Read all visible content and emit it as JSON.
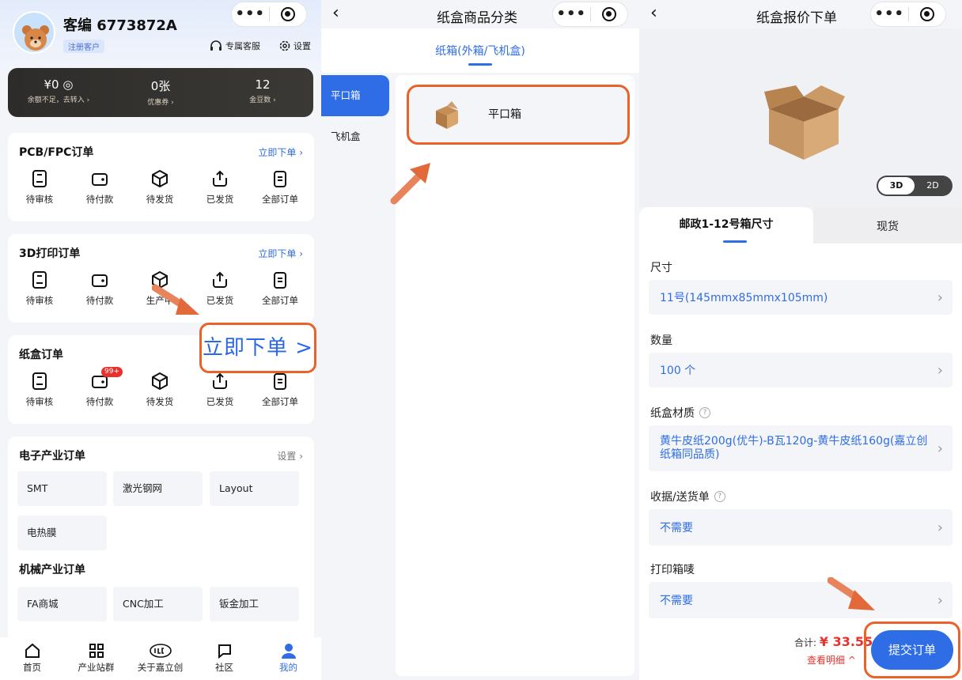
{
  "left": {
    "user": {
      "name": "客编 6773872A",
      "badge": "注册客户"
    },
    "header_links": {
      "service": "专属客服",
      "settings": "设置"
    },
    "stats": [
      {
        "value": "¥0 ◎",
        "sub": "余额不足，去转入 ›"
      },
      {
        "value": "0张",
        "sub": "优惠券 ›"
      },
      {
        "value": "12",
        "sub": "金豆数 ›"
      }
    ],
    "pcb": {
      "title": "PCB/FPC订单",
      "link": "立即下单 ›",
      "items": [
        "待审核",
        "待付款",
        "待发货",
        "已发货",
        "全部订单"
      ]
    },
    "print3d": {
      "title": "3D打印订单",
      "link": "立即下单 ›",
      "items": [
        "待审核",
        "待付款",
        "生产中",
        "已发货",
        "全部订单"
      ]
    },
    "box": {
      "title": "纸盒订单",
      "badge": "99+",
      "items": [
        "待审核",
        "待付款",
        "待发货",
        "已发货",
        "全部订单"
      ]
    },
    "callout": "立即下单 >",
    "electronics": {
      "title": "电子产业订单",
      "link": "设置 ›",
      "tiles": [
        "SMT",
        "激光钢网",
        "Layout",
        "电热膜"
      ]
    },
    "mechanical": {
      "title": "机械产业订单",
      "tiles": [
        "FA商城",
        "CNC加工",
        "钣金加工"
      ]
    },
    "tabbar": [
      "首页",
      "产业站群",
      "关于嘉立创",
      "社区",
      "我的"
    ],
    "tabbar_active_color": "#2f6de6"
  },
  "middle": {
    "title": "纸盒商品分类",
    "tab": "纸箱(外箱/飞机盒)",
    "menu": [
      "平口箱",
      "飞机盒"
    ],
    "item": "平口箱"
  },
  "right": {
    "title": "纸盒报价下单",
    "toggle": [
      "3D",
      "2D"
    ],
    "tabs": [
      "邮政1-12号箱尺寸",
      "现货"
    ],
    "fields": [
      {
        "label": "尺寸",
        "value": "11号(145mmx85mmx105mm)"
      },
      {
        "label": "数量",
        "value": "100 个"
      },
      {
        "label": "纸盒材质",
        "value": "黄牛皮纸200g(优牛)-B瓦120g-黄牛皮纸160g(嘉立创纸箱同品质)"
      },
      {
        "label": "收据/送货单",
        "value": "不需要"
      },
      {
        "label": "打印箱唛",
        "value": "不需要"
      }
    ],
    "total_label": "合计: ",
    "total": "¥ 33.55",
    "detail": "查看明细 ^",
    "submit": "提交订单"
  },
  "colors": {
    "accent": "#2f6de6",
    "highlight": "#e8622a",
    "price": "#e8312d"
  }
}
